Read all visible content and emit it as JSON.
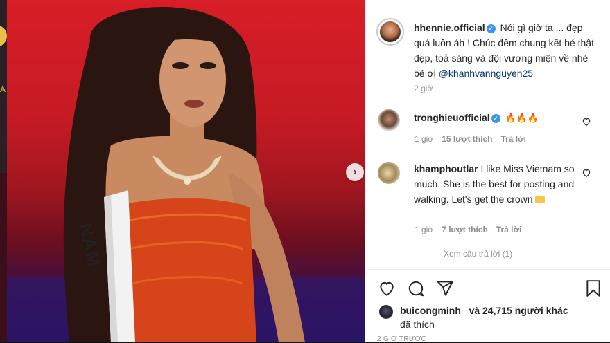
{
  "backdrop": {
    "glyph": "A"
  },
  "post": {
    "author": "hhennie.official",
    "caption": "Nói gì giờ ta ... đẹp quá luôn áh ! Chúc đêm chung kết bé thật đẹp, toả sáng và đội vương miện về nhé bé ơi",
    "mention": "@khanhvannguyen25",
    "age": "2 giờ"
  },
  "photo": {
    "sash_text": "NAM"
  },
  "comments": [
    {
      "username": "tronghieuofficial",
      "text": "🔥🔥🔥",
      "time": "1 giờ",
      "likes": "15 lượt thích",
      "reply": "Trả lời",
      "verified": true
    },
    {
      "username": "khamphoutlar",
      "text": "I like Miss Vietnam so much. She is the best for posting and walking. Let's get the crown",
      "time": "1 giờ",
      "likes": "7 lượt thích",
      "reply": "Trả lời",
      "view_replies": "Xem câu trả lời (1)"
    }
  ],
  "likes": {
    "user": "buicongminh_",
    "rest": "và 24,715 người khác",
    "line2": "đã thích"
  },
  "timestamp": "2 GIỜ TRƯỚC",
  "icons": [
    "heart-icon",
    "comment-icon",
    "share-icon",
    "bookmark-icon",
    "verified-icon",
    "chevron-right-icon"
  ]
}
